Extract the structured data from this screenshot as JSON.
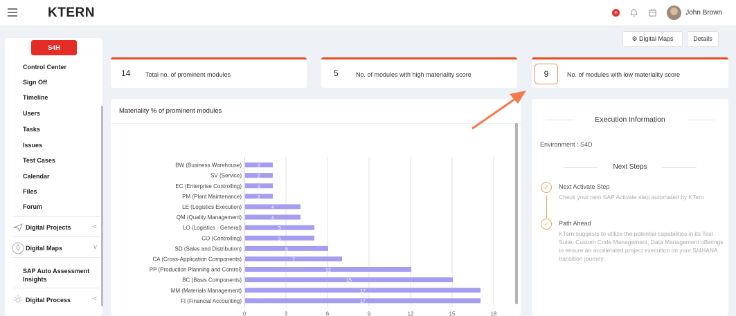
{
  "header": {
    "logo": "KTERN",
    "notification_dot": "+",
    "user_name": "John Brown"
  },
  "sidebar": {
    "badge": "S4H",
    "items": [
      {
        "label": "Control Center"
      },
      {
        "label": "Sign Off"
      },
      {
        "label": "Timeline"
      },
      {
        "label": "Users"
      },
      {
        "label": "Tasks"
      },
      {
        "label": "Issues"
      },
      {
        "label": "Test Cases"
      },
      {
        "label": "Calendar"
      },
      {
        "label": "Files"
      },
      {
        "label": "Forum"
      }
    ],
    "groups": [
      {
        "label": "Digital Projects",
        "icon": "send-icon",
        "chevron": "<"
      },
      {
        "label": "Digital Maps",
        "icon": "map-drop-icon",
        "chevron": "v"
      },
      {
        "label": "SAP Auto Assessment Insights"
      },
      {
        "label": "Digital Process",
        "icon": "sun-icon",
        "chevron": "<"
      }
    ]
  },
  "toolbar": {
    "digital_maps": "Digital Maps",
    "details": "Details"
  },
  "stats": [
    {
      "value": "14",
      "label": "Total no. of prominent modules"
    },
    {
      "value": "5",
      "label": "No. of modules with high materiality score"
    },
    {
      "value": "9",
      "label": "No. of modules with low materiality score"
    }
  ],
  "chart_panel": {
    "title": "Materiality % of prominent modules"
  },
  "chart_data": {
    "type": "bar",
    "orientation": "horizontal",
    "title": "Materiality % of prominent modules",
    "categories": [
      "BW (Business Warehouse)",
      "SV (Service)",
      "EC (Enterprise Controlling)",
      "PM (Plant Maintenance)",
      "LE (Logistics Execution)",
      "QM (Quality Management)",
      "LO (Logistics - General)",
      "CO (Controlling)",
      "SD (Sales and Distribution)",
      "CA (Cross-Application Components)",
      "PP (Production Planning and Control)",
      "BC (Basis Components)",
      "MM (Materials Management)",
      "FI (Financial Accounting)"
    ],
    "values": [
      2,
      2,
      2,
      2,
      4,
      4,
      5,
      5,
      6,
      7,
      12,
      15,
      17,
      17
    ],
    "xticks": [
      "0",
      "3",
      "6",
      "9",
      "12",
      "15",
      "18"
    ],
    "xlim": [
      0,
      18
    ],
    "grid": true,
    "bar_color": "#a49df0",
    "label_color": "#ffffff"
  },
  "info": {
    "title": "Execution Information",
    "environment": "Environment : S4D",
    "next_steps_title": "Next Steps",
    "steps": [
      {
        "title": "Next Activate Step",
        "desc": "Check your next SAP Activate step automated by KTern"
      },
      {
        "title": "Path Ahead",
        "desc": "KTern suggests to utilize the potential capabilities in its Test Suite, Custom Code Management, Data Management offerings to ensure an accelerated project execution on your S/4HANA transition journey."
      }
    ]
  },
  "colors": {
    "accent": "#e84c1e",
    "brand_red": "#e52d27",
    "step_orange": "#f0a04b",
    "arrow": "#f47a4a"
  }
}
